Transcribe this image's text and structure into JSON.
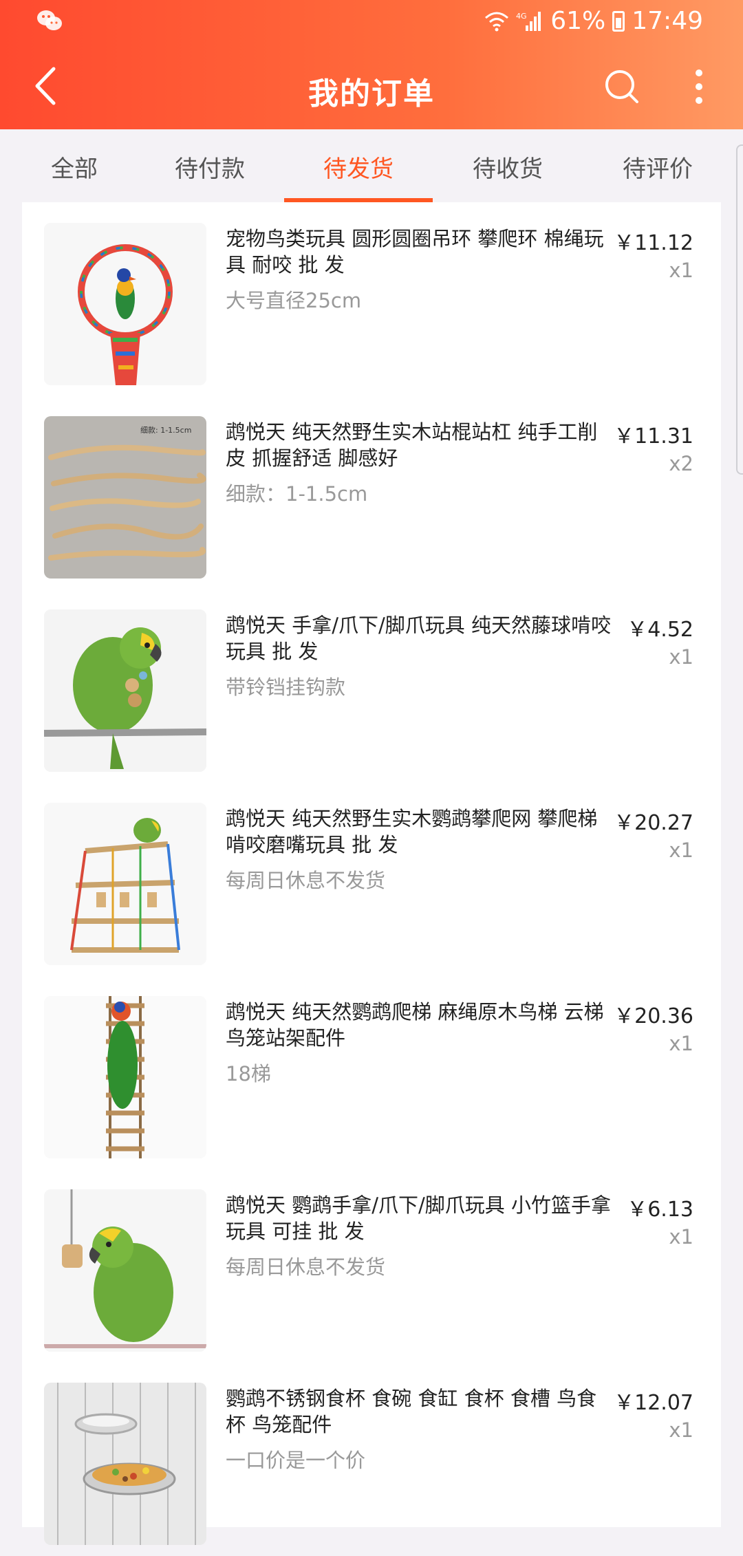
{
  "status_bar": {
    "wechat_icon": "wechat-icon",
    "network": "4G",
    "battery": "61%",
    "time": "17:49"
  },
  "header": {
    "title": "我的订单",
    "back_icon": "back-arrow-icon",
    "search_icon": "search-icon",
    "more_icon": "more-vertical-icon",
    "gradient_colors": [
      "#ff4a2f",
      "#ff9a63"
    ]
  },
  "tabs": [
    {
      "label": "全部"
    },
    {
      "label": "待付款"
    },
    {
      "label": "待发货",
      "active": true
    },
    {
      "label": "待收货"
    },
    {
      "label": "待评价"
    }
  ],
  "accent_color": "#ff5722",
  "orders": [
    {
      "name": "宠物鸟类玩具 圆形圆圈吊环 攀爬环 棉绳玩具 耐咬 批 发",
      "spec": "大号直径25cm",
      "price": "￥11.12",
      "qty": "x1"
    },
    {
      "name": "鹉悦天 纯天然野生实木站棍站杠 纯手工削皮 抓握舒适 脚感好",
      "spec": "细款：1-1.5cm",
      "price": "￥11.31",
      "qty": "x2",
      "image_text": "细款: 1-1.5cm"
    },
    {
      "name": "鹉悦天 手拿/爪下/脚爪玩具 纯天然藤球啃咬玩具 批 发",
      "spec": "带铃铛挂钩款",
      "price": "￥4.52",
      "qty": "x1"
    },
    {
      "name": "鹉悦天 纯天然野生实木鹦鹉攀爬网 攀爬梯 啃咬磨嘴玩具 批 发",
      "spec": "每周日休息不发货",
      "price": "￥20.27",
      "qty": "x1"
    },
    {
      "name": "鹉悦天 纯天然鹦鹉爬梯 麻绳原木鸟梯 云梯 鸟笼站架配件",
      "spec": "18梯",
      "price": "￥20.36",
      "qty": "x1"
    },
    {
      "name": "鹉悦天 鹦鹉手拿/爪下/脚爪玩具 小竹篮手拿玩具 可挂 批 发",
      "spec": "每周日休息不发货",
      "price": "￥6.13",
      "qty": "x1"
    },
    {
      "name": "鹦鹉不锈钢食杯 食碗 食缸 食杯 食槽 鸟食杯 鸟笼配件",
      "spec": "一口价是一个价",
      "price": "￥12.07",
      "qty": "x1"
    }
  ]
}
